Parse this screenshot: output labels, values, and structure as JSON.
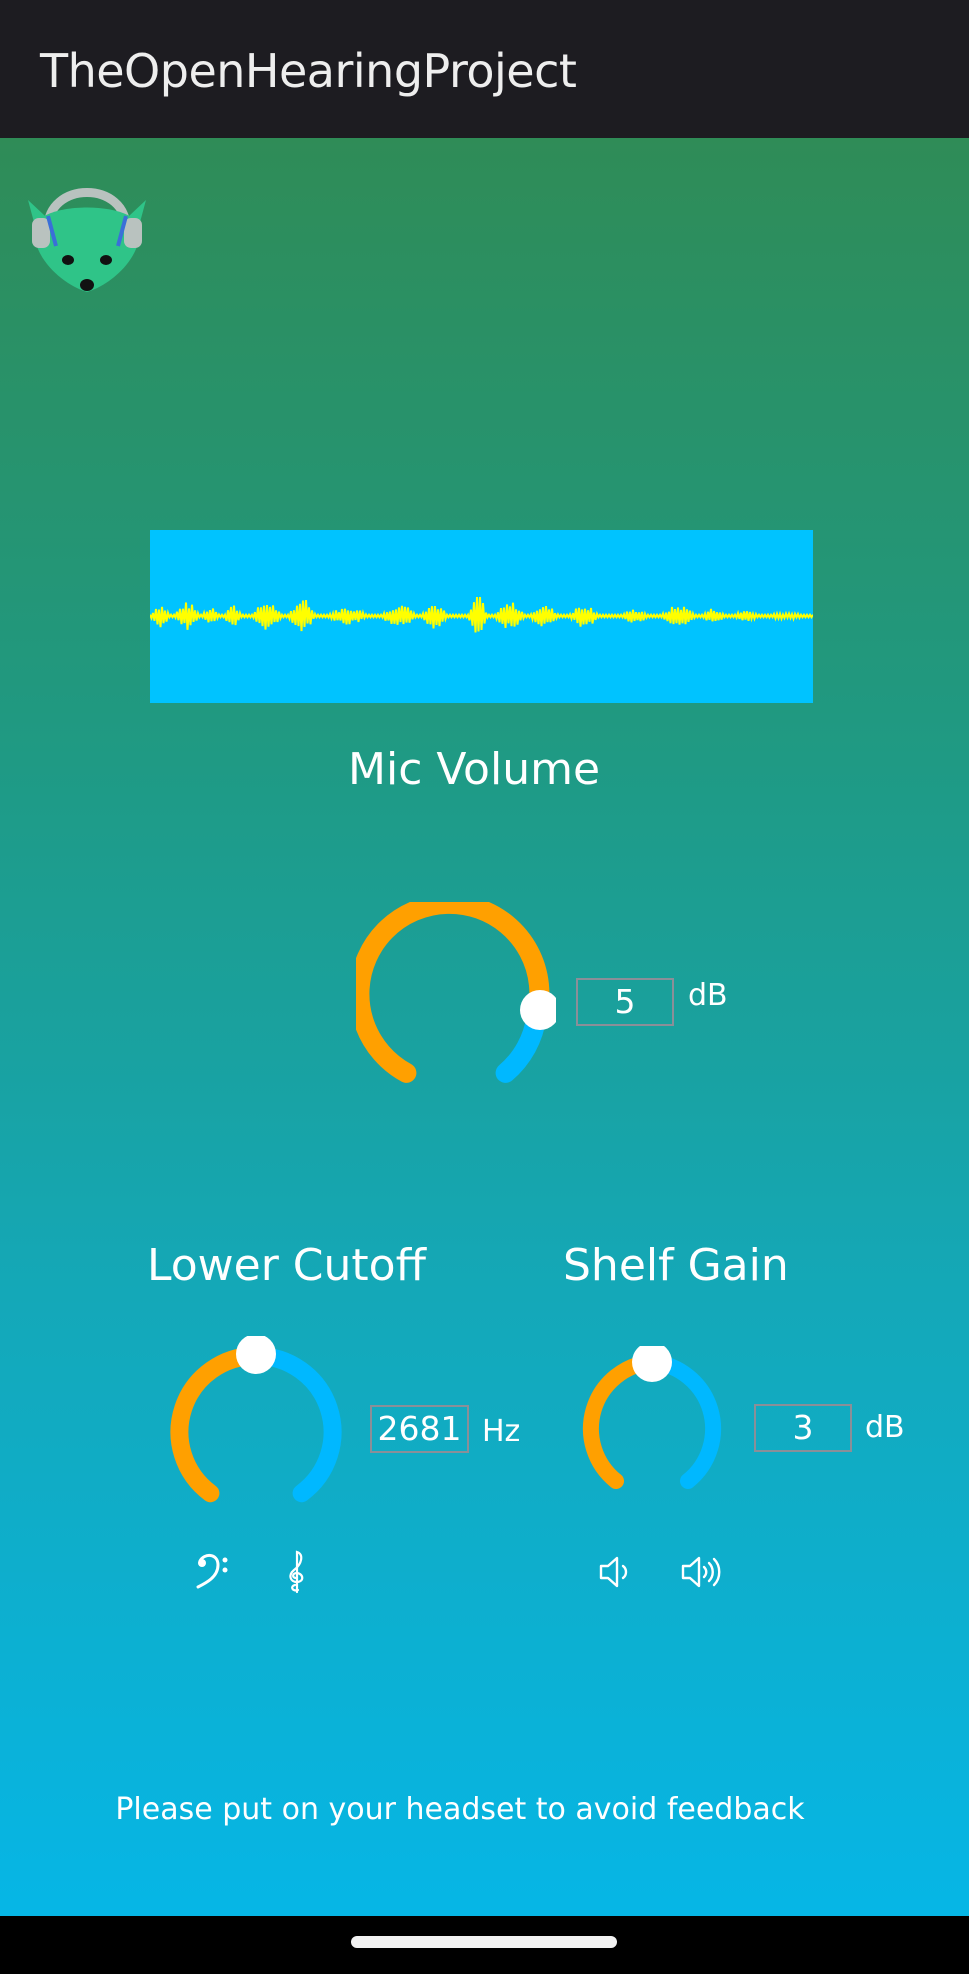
{
  "app": {
    "title": "TheOpenHearingProject"
  },
  "logo": {
    "icon": "fox-headphones-icon"
  },
  "colors": {
    "accent_orange": "#ffa000",
    "accent_blue": "#00b8ff",
    "waveform_bg": "#00c3ff",
    "waveform_fg": "#ffff00"
  },
  "mic_volume": {
    "label": "Mic Volume",
    "value": "5",
    "unit": "dB",
    "level": 0.84
  },
  "lower_cutoff": {
    "label": "Lower Cutoff",
    "value": "2681",
    "unit": "Hz",
    "level": 0.5,
    "icons": [
      "bass-clef-icon",
      "treble-clef-icon"
    ]
  },
  "shelf_gain": {
    "label": "Shelf Gain",
    "value": "3",
    "unit": "dB",
    "level": 0.5,
    "icons": [
      "speaker-low-icon",
      "speaker-high-icon"
    ]
  },
  "footer": {
    "message": "Please put on your headset to avoid feedback"
  }
}
